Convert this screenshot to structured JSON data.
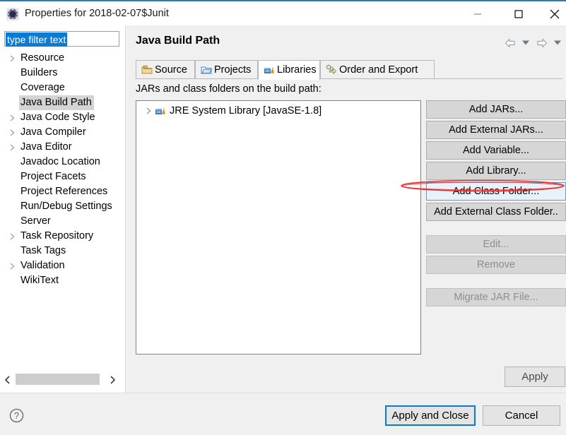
{
  "window": {
    "title": "Properties for 2018-02-07$Junit",
    "icon": "eclipse-properties-icon",
    "minimize_label": "Minimize",
    "maximize_label": "Maximize",
    "close_label": "Close"
  },
  "filter": {
    "value": "type filter text",
    "placeholder": "type filter text"
  },
  "sidebar": {
    "items": [
      {
        "label": "Resource",
        "expandable": true,
        "selected": false
      },
      {
        "label": "Builders",
        "expandable": false,
        "selected": false
      },
      {
        "label": "Coverage",
        "expandable": false,
        "selected": false
      },
      {
        "label": "Java Build Path",
        "expandable": false,
        "selected": true
      },
      {
        "label": "Java Code Style",
        "expandable": true,
        "selected": false
      },
      {
        "label": "Java Compiler",
        "expandable": true,
        "selected": false
      },
      {
        "label": "Java Editor",
        "expandable": true,
        "selected": false
      },
      {
        "label": "Javadoc Location",
        "expandable": false,
        "selected": false
      },
      {
        "label": "Project Facets",
        "expandable": false,
        "selected": false
      },
      {
        "label": "Project References",
        "expandable": false,
        "selected": false
      },
      {
        "label": "Run/Debug Settings",
        "expandable": false,
        "selected": false
      },
      {
        "label": "Server",
        "expandable": false,
        "selected": false
      },
      {
        "label": "Task Repository",
        "expandable": true,
        "selected": false
      },
      {
        "label": "Task Tags",
        "expandable": false,
        "selected": false
      },
      {
        "label": "Validation",
        "expandable": true,
        "selected": false
      },
      {
        "label": "WikiText",
        "expandable": false,
        "selected": false
      }
    ],
    "scroll_left_icon": "chevron-left-icon",
    "scroll_right_icon": "chevron-right-icon"
  },
  "page": {
    "title": "Java Build Path",
    "nav": {
      "back_icon": "arrow-back-icon",
      "back_menu_icon": "chevron-down-icon",
      "forward_icon": "arrow-forward-icon",
      "forward_menu_icon": "chevron-down-icon"
    },
    "tabs": [
      {
        "label": "Source",
        "icon": "source-folder-icon",
        "active": false
      },
      {
        "label": "Projects",
        "icon": "projects-folder-icon",
        "active": false
      },
      {
        "label": "Libraries",
        "icon": "libraries-icon",
        "active": true
      },
      {
        "label": "Order and Export",
        "icon": "order-export-icon",
        "active": false
      }
    ],
    "content_label": "JARs and class folders on the build path:",
    "library_tree": [
      {
        "label": "JRE System Library [JavaSE-1.8]",
        "icon": "library-icon",
        "expandable": true
      }
    ],
    "side_buttons": [
      {
        "label": "Add JARs...",
        "state": "normal"
      },
      {
        "label": "Add External JARs...",
        "state": "normal"
      },
      {
        "label": "Add Variable...",
        "state": "normal"
      },
      {
        "label": "Add Library...",
        "state": "normal"
      },
      {
        "label": "Add Class Folder...",
        "state": "focused"
      },
      {
        "label": "Add External Class Folder..",
        "state": "normal"
      },
      {
        "label": "Edit...",
        "state": "disabled"
      },
      {
        "label": "Remove",
        "state": "disabled"
      },
      {
        "label": "Migrate JAR File...",
        "state": "disabled"
      }
    ]
  },
  "annotation": {
    "shape": "red-ellipse",
    "color": "#e8312f",
    "target": "Add Library..."
  },
  "footer": {
    "apply_label": "Apply",
    "apply_and_close_label": "Apply and Close",
    "cancel_label": "Cancel",
    "help_icon": "help-question-icon"
  },
  "colors": {
    "accent": "#0a7bd4",
    "titlebar_accent": "#2b7cb5",
    "selection_gray": "#d4d4d4",
    "button_face": "#d6d6d6",
    "annotation_red": "#e8312f"
  }
}
